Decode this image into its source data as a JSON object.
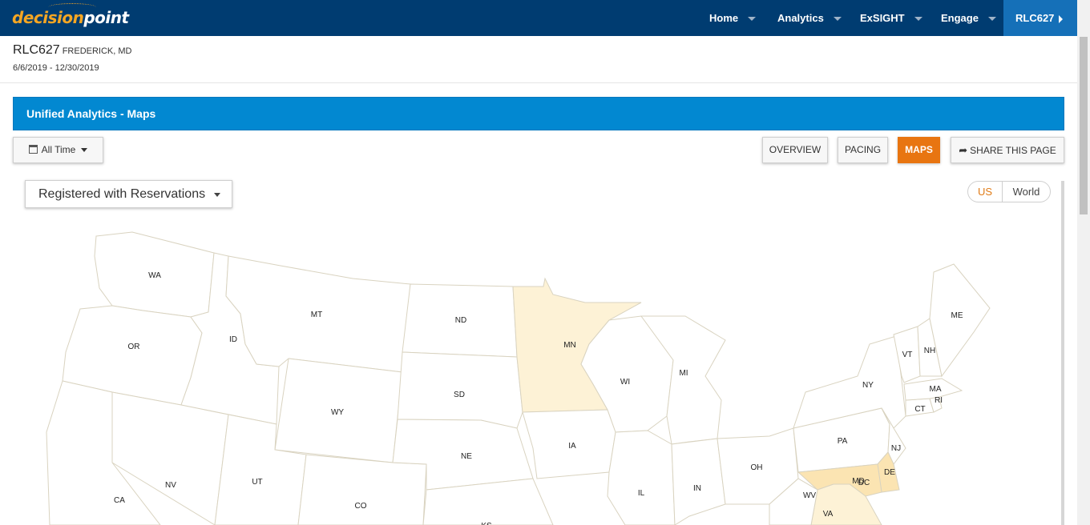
{
  "navbar": {
    "logo_part1": "decision",
    "logo_part2": "point",
    "items": [
      "Home",
      "Analytics",
      "ExSIGHT",
      "Engage"
    ],
    "account": "RLC627"
  },
  "header": {
    "site_code": "RLC627",
    "site_location": "FREDERICK, MD",
    "date_range": "6/6/2019 - 12/30/2019"
  },
  "titlebar": {
    "title": "Unified Analytics - Maps"
  },
  "toolbar": {
    "time_filter": "All Time",
    "overview": "OVERVIEW",
    "pacing": "PACING",
    "maps": "MAPS",
    "share": "SHARE THIS PAGE"
  },
  "map": {
    "metric": "Registered with Reservations",
    "toggle_us": "US",
    "toggle_world": "World",
    "state_labels": {
      "WA": "WA",
      "OR": "OR",
      "ID": "ID",
      "MT": "MT",
      "ND": "ND",
      "MN": "MN",
      "SD": "SD",
      "WY": "WY",
      "WI": "WI",
      "MI": "MI",
      "IA": "IA",
      "NE": "NE",
      "NV": "NV",
      "UT": "UT",
      "CO": "CO",
      "CA": "CA",
      "KS": "KS",
      "IL": "IL",
      "IN": "IN",
      "OH": "OH",
      "PA": "PA",
      "NY": "NY",
      "WV": "WV",
      "VA": "VA",
      "MD": "MD",
      "DC": "DC",
      "DE": "DE",
      "NJ": "NJ",
      "CT": "CT",
      "RI": "RI",
      "MA": "MA",
      "VT": "VT",
      "NH": "NH",
      "ME": "ME"
    },
    "highlighted_states": [
      "MN",
      "MD",
      "VA",
      "DE"
    ],
    "colors": {
      "low": "#fdf2d6",
      "mid": "#fbe4b2",
      "accent": "#e87511",
      "title_bar": "#0288d1",
      "navbar": "#003c71"
    }
  }
}
